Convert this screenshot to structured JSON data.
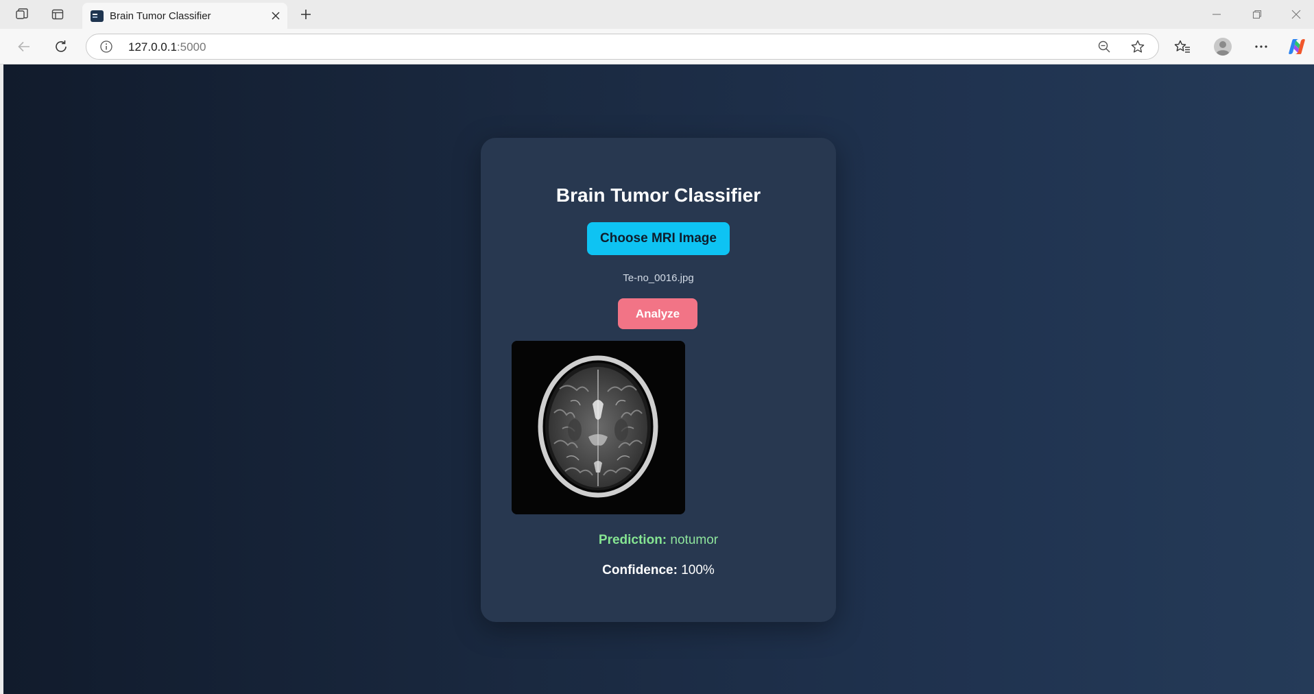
{
  "browser": {
    "tab_title": "Brain Tumor Classifier",
    "url_host": "127.0.0.1",
    "url_port": ":5000"
  },
  "page": {
    "title": "Brain Tumor Classifier",
    "choose_button_label": "Choose MRI Image",
    "file_name": "Te-no_0016.jpg",
    "analyze_button_label": "Analyze",
    "prediction_label": "Prediction:",
    "prediction_value": "notumor",
    "confidence_label": "Confidence:",
    "confidence_value": "100%"
  },
  "colors": {
    "page_bg_start": "#111b2c",
    "page_bg_end": "#253b58",
    "card_bg": "#283850",
    "choose_button": "#0ec3f3",
    "analyze_button": "#f27486",
    "prediction_text": "#8fe59d"
  }
}
